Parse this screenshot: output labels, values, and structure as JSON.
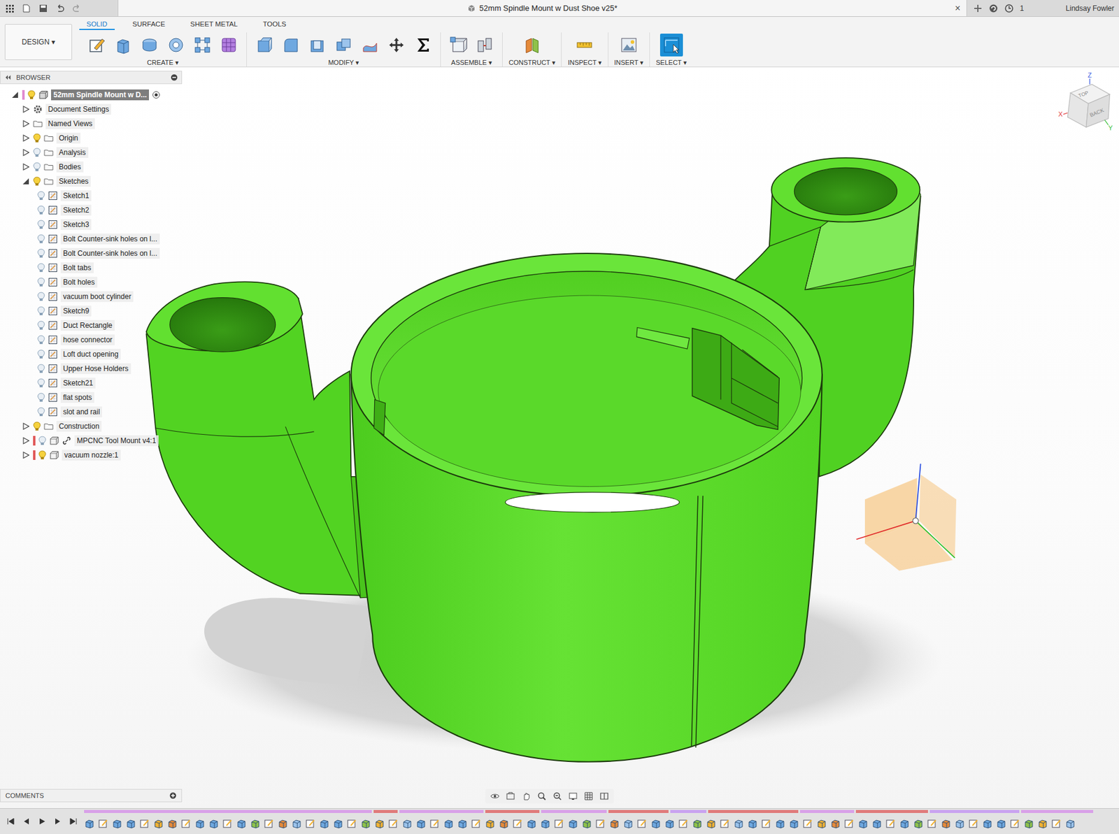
{
  "window": {
    "title": "52mm Spindle Mount w Dust Shoe v25*",
    "close": "×",
    "notifications": "1",
    "user": "Lindsay Fowler"
  },
  "workspace": {
    "label": "DESIGN ▾"
  },
  "tabs": [
    {
      "label": "SOLID",
      "selected": true
    },
    {
      "label": "SURFACE",
      "selected": false
    },
    {
      "label": "SHEET METAL",
      "selected": false
    },
    {
      "label": "TOOLS",
      "selected": false
    }
  ],
  "groups": [
    {
      "label": "CREATE ▾",
      "active": false
    },
    {
      "label": "MODIFY ▾",
      "active": false
    },
    {
      "label": "ASSEMBLE ▾",
      "active": false
    },
    {
      "label": "CONSTRUCT ▾",
      "active": false
    },
    {
      "label": "INSPECT ▾",
      "active": false
    },
    {
      "label": "INSERT ▾",
      "active": false
    },
    {
      "label": "SELECT ▾",
      "active": true
    }
  ],
  "browser": {
    "title": "BROWSER",
    "items": [
      {
        "label": "52mm Spindle Mount w D...",
        "depth": 0,
        "kind": "root",
        "expandable": true,
        "expanded": true,
        "visible": true,
        "selected": true,
        "linked": false
      },
      {
        "label": "Document Settings",
        "depth": 1,
        "kind": "settings",
        "expandable": true,
        "expanded": false,
        "selected": false
      },
      {
        "label": "Named Views",
        "depth": 1,
        "kind": "views",
        "expandable": true,
        "expanded": false,
        "selected": false
      },
      {
        "label": "Origin",
        "depth": 1,
        "kind": "folder",
        "expandable": true,
        "expanded": false,
        "visible": true,
        "selected": false
      },
      {
        "label": "Analysis",
        "depth": 1,
        "kind": "folder",
        "expandable": true,
        "expanded": false,
        "visible": false,
        "selected": false
      },
      {
        "label": "Bodies",
        "depth": 1,
        "kind": "folder",
        "expandable": true,
        "expanded": false,
        "visible": false,
        "selected": false
      },
      {
        "label": "Sketches",
        "depth": 1,
        "kind": "folder",
        "expandable": true,
        "expanded": true,
        "visible": true,
        "selected": false
      },
      {
        "label": "Sketch1",
        "depth": 2,
        "kind": "sketch",
        "expandable": false,
        "expanded": false,
        "visible": false,
        "selected": false
      },
      {
        "label": "Sketch2",
        "depth": 2,
        "kind": "sketch",
        "expandable": false,
        "expanded": false,
        "visible": false,
        "selected": false
      },
      {
        "label": "Sketch3",
        "depth": 2,
        "kind": "sketch",
        "expandable": false,
        "expanded": false,
        "visible": false,
        "selected": false
      },
      {
        "label": "Bolt Counter-sink holes on l...",
        "depth": 2,
        "kind": "sketch",
        "expandable": false,
        "expanded": false,
        "visible": false,
        "selected": false
      },
      {
        "label": "Bolt Counter-sink holes on l...",
        "depth": 2,
        "kind": "sketch",
        "expandable": false,
        "expanded": false,
        "visible": false,
        "selected": false
      },
      {
        "label": "Bolt tabs",
        "depth": 2,
        "kind": "sketch",
        "expandable": false,
        "expanded": false,
        "visible": false,
        "selected": false
      },
      {
        "label": "Bolt holes",
        "depth": 2,
        "kind": "sketch",
        "expandable": false,
        "expanded": false,
        "visible": false,
        "selected": false
      },
      {
        "label": "vacuum boot cylinder",
        "depth": 2,
        "kind": "sketch",
        "expandable": false,
        "expanded": false,
        "visible": false,
        "selected": false
      },
      {
        "label": "Sketch9",
        "depth": 2,
        "kind": "sketch",
        "expandable": false,
        "expanded": false,
        "visible": false,
        "selected": false
      },
      {
        "label": "Duct Rectangle",
        "depth": 2,
        "kind": "sketch",
        "expandable": false,
        "expanded": false,
        "visible": false,
        "selected": false
      },
      {
        "label": "hose connector",
        "depth": 2,
        "kind": "sketch",
        "expandable": false,
        "expanded": false,
        "visible": false,
        "selected": false
      },
      {
        "label": "Loft duct opening",
        "depth": 2,
        "kind": "sketch",
        "expandable": false,
        "expanded": false,
        "visible": false,
        "selected": false
      },
      {
        "label": "Upper Hose Holders",
        "depth": 2,
        "kind": "sketch",
        "expandable": false,
        "expanded": false,
        "visible": false,
        "selected": false
      },
      {
        "label": "Sketch21",
        "depth": 2,
        "kind": "sketch",
        "expandable": false,
        "expanded": false,
        "visible": false,
        "selected": false
      },
      {
        "label": "flat spots",
        "depth": 2,
        "kind": "sketch",
        "expandable": false,
        "expanded": false,
        "visible": false,
        "selected": false
      },
      {
        "label": "slot and rail",
        "depth": 2,
        "kind": "sketch",
        "expandable": false,
        "expanded": false,
        "visible": false,
        "selected": false
      },
      {
        "label": "Construction",
        "depth": 1,
        "kind": "folder",
        "expandable": true,
        "expanded": false,
        "visible": true,
        "selected": false
      },
      {
        "label": "MPCNC Tool Mount v4:1",
        "depth": 1,
        "kind": "component",
        "expandable": true,
        "expanded": false,
        "visible": false,
        "selected": false,
        "linked": true
      },
      {
        "label": "vacuum nozzle:1",
        "depth": 1,
        "kind": "component",
        "expandable": true,
        "expanded": false,
        "visible": true,
        "selected": false,
        "linked": false
      }
    ]
  },
  "viewcube": {
    "faces": [
      "TOP",
      "BACK"
    ],
    "axes": [
      "Z",
      "X",
      "Y"
    ]
  },
  "comments": {
    "title": "COMMENTS"
  }
}
